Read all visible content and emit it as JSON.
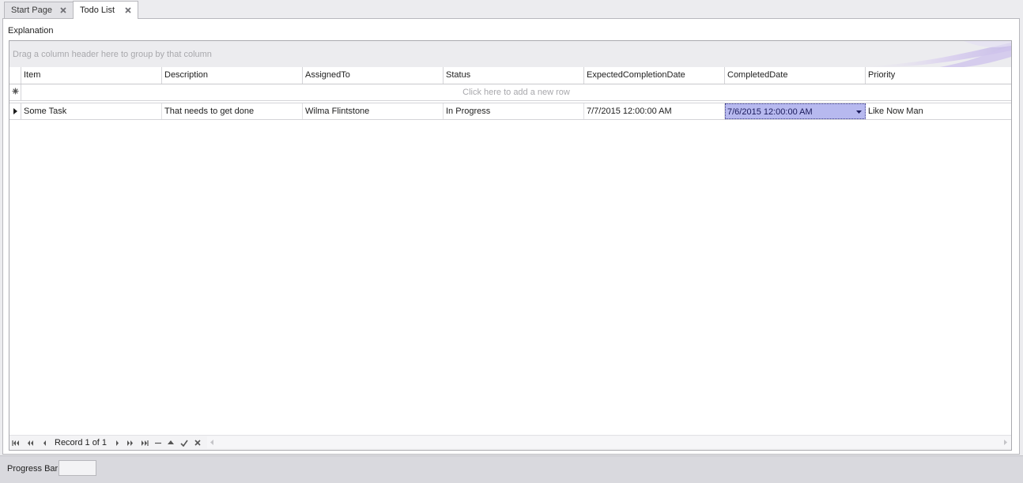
{
  "tabs": [
    {
      "label": "Start Page",
      "active": false
    },
    {
      "label": "Todo List",
      "active": true
    }
  ],
  "panel": {
    "caption": "Explanation"
  },
  "grid": {
    "group_panel_hint": "Drag a column header here to group by that column",
    "new_row_hint": "Click here to add a new row",
    "columns": [
      "Item",
      "Description",
      "AssignedTo",
      "Status",
      "ExpectedCompletionDate",
      "CompletedDate",
      "Priority"
    ],
    "rows": [
      [
        "Some Task",
        "That needs to get done",
        "Wilma Flintstone",
        "In Progress",
        "7/7/2015 12:00:00 AM",
        "7/6/2015 12:00:00 AM",
        "Like Now Man"
      ]
    ],
    "editing_cell": {
      "row": 0,
      "column": "CompletedDate"
    },
    "selection_color": "#b7b9ef"
  },
  "navigator": {
    "record_text": "Record 1 of 1"
  },
  "statusbar": {
    "progress_label": "Progress Bar"
  }
}
